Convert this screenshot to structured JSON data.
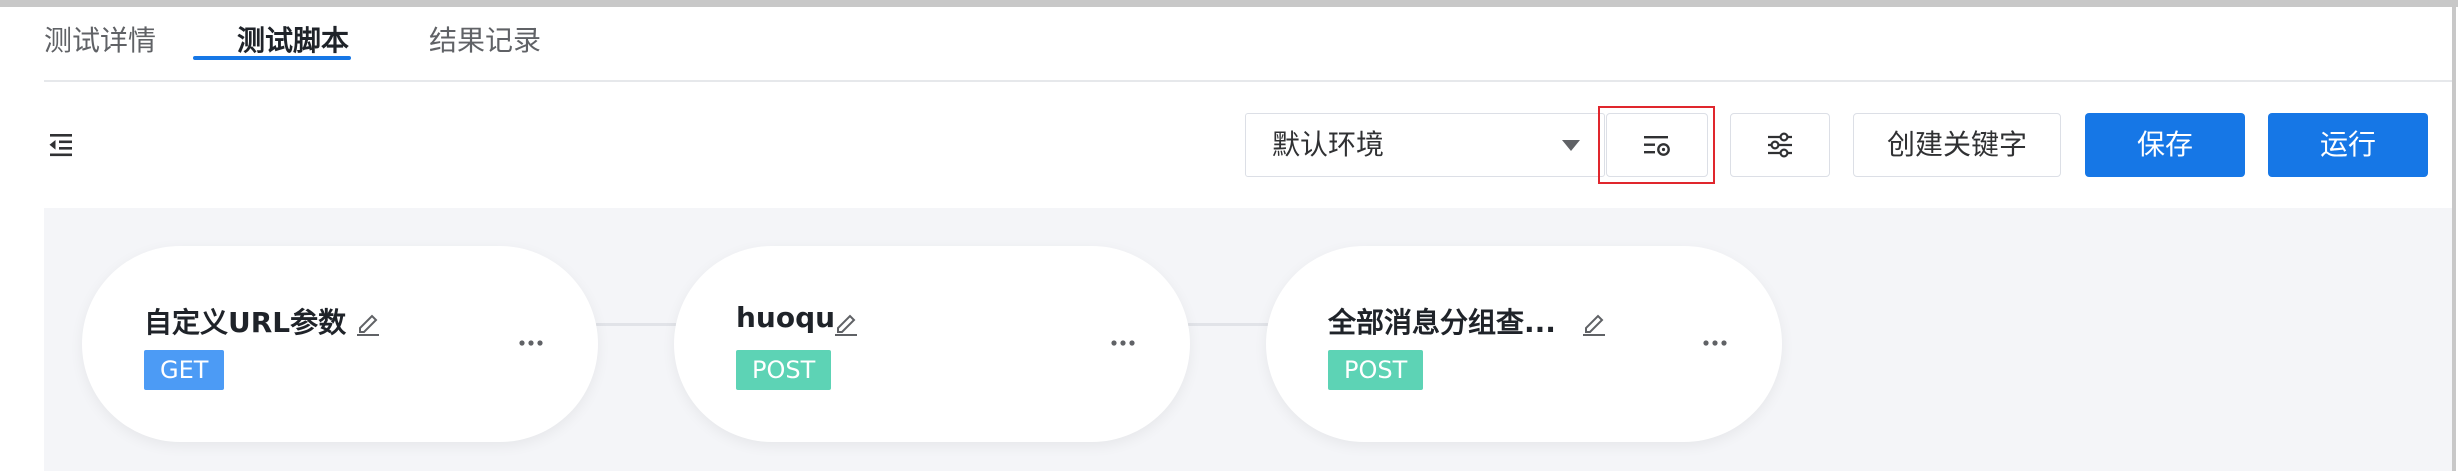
{
  "tabs": [
    {
      "label": "测试详情",
      "active": false
    },
    {
      "label": "测试脚本",
      "active": true
    },
    {
      "label": "结果记录",
      "active": false
    }
  ],
  "toolbar": {
    "collapse_icon": "outdent-icon",
    "environment": {
      "value": "默认环境",
      "caret_icon": "caret-down-icon"
    },
    "env_config_icon": "list-settings-icon",
    "params_icon": "sliders-icon",
    "keyword_button": "创建关键字",
    "save_button": "保存",
    "run_button": "运行"
  },
  "flow": {
    "nodes": [
      {
        "title": "自定义URL参数",
        "method": "GET",
        "method_color": "#4c9bf5",
        "edit_icon": "pencil-icon",
        "more_icon": "more-horizontal-icon"
      },
      {
        "title": "huoqu",
        "method": "POST",
        "method_color": "#5dd3b5",
        "edit_icon": "pencil-icon",
        "more_icon": "more-horizontal-icon"
      },
      {
        "title": "全部消息分组查...",
        "method": "POST",
        "method_color": "#5dd3b5",
        "edit_icon": "pencil-icon",
        "more_icon": "more-horizontal-icon"
      }
    ]
  },
  "colors": {
    "primary": "#1677e6",
    "highlight": "#e0262d",
    "canvas_bg": "#f4f5f8"
  }
}
